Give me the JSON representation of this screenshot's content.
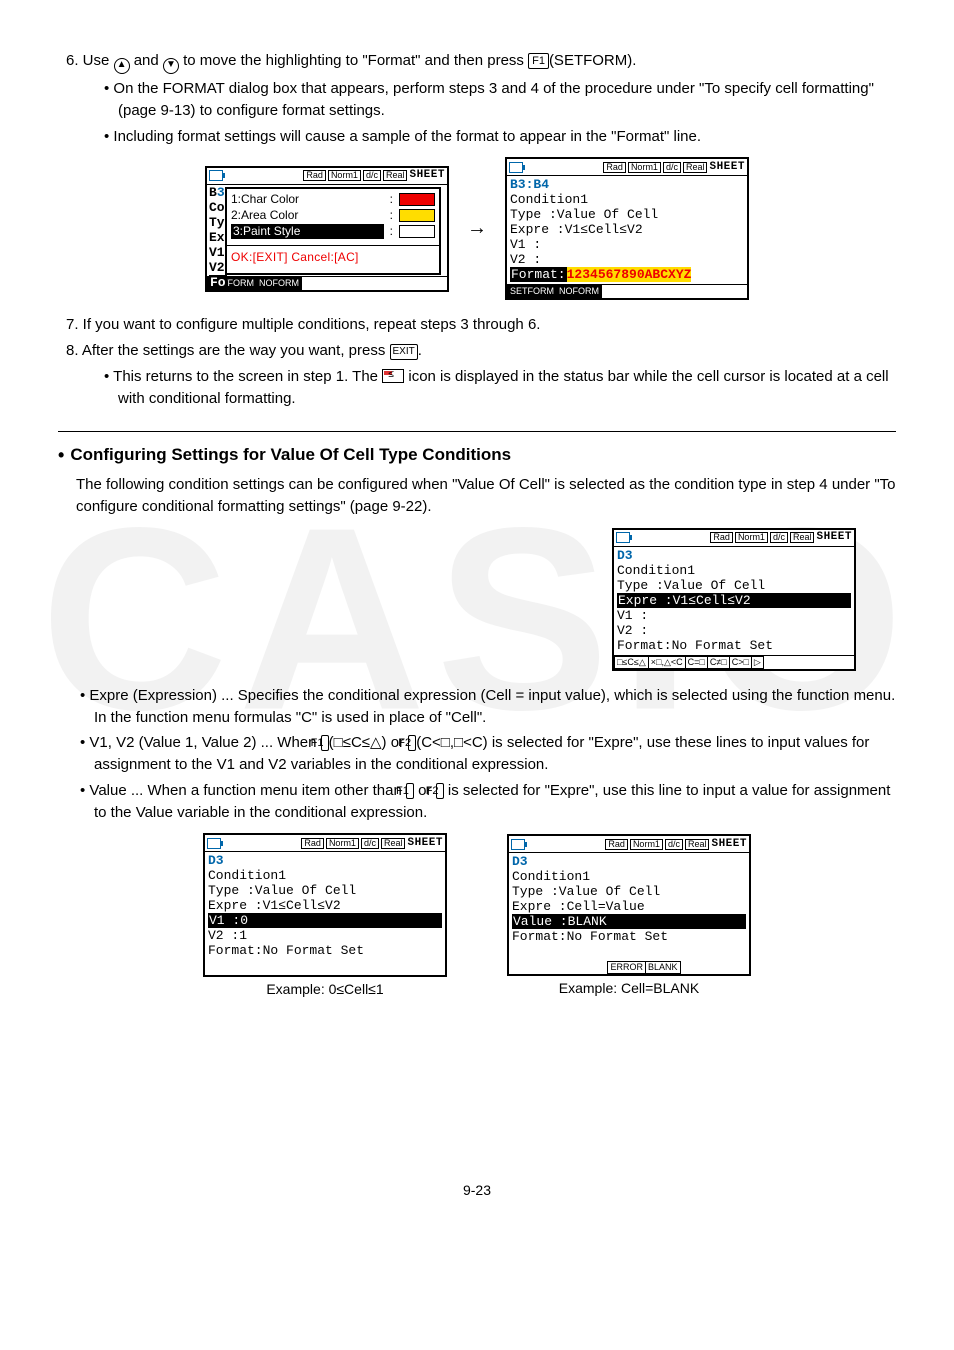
{
  "step6": {
    "text_a": "6. Use ",
    "text_b": " and ",
    "text_c": " to move the highlighting to \"Format\" and then press ",
    "text_d": "(SETFORM).",
    "sub1": "On the FORMAT dialog box that appears, perform steps 3 and 4 of the procedure under \"To specify cell formatting\" (page 9-13) to configure format settings.",
    "sub2": "Including format settings will cause a sample of the format to appear in the \"Format\" line."
  },
  "keys": {
    "up": "▲",
    "down": "▼",
    "f1": "F1",
    "f2": "F2",
    "exit": "EXIT"
  },
  "screens_pair1": {
    "leftPeek": "B3\nCo\nTy\nEx\nV1\nV2\nFo",
    "dlg_opt1": "1:Char Color",
    "dlg_opt2": "2:Area Color",
    "dlg_opt3": "3:Paint Style",
    "dlg_foot": "OK:[EXIT] Cancel:[AC]",
    "fkeys_left": [
      "SETFORM",
      "NOFORM"
    ],
    "cell": "B3:B4",
    "cond": "Condition1",
    "type": "Type   :Value Of Cell",
    "expre": "Expre  :V1≤Cell≤V2",
    "v1": "V1     :",
    "v2": "V2     :",
    "fmtlabel": "Format:",
    "fmtval": "1234567890ABCXYZ",
    "fkeys_right": [
      "SETFORM",
      "NOFORM"
    ]
  },
  "status": {
    "rad": "Rad",
    "norm": "Norm1",
    "dc": "d/c",
    "real": "Real",
    "sheet": "SHEET"
  },
  "step7": "7. If you want to configure multiple conditions, repeat steps 3 through 6.",
  "step8a": "8. After the settings are the way you want, press ",
  "step8b": ".",
  "step8_sub_a": "This returns to the screen in step 1. The ",
  "step8_sub_b": " icon is displayed in the status bar while the cell cursor is located at a cell with conditional formatting.",
  "sect2": {
    "title": "Configuring Settings for Value Of Cell Type Conditions",
    "lead": "The following condition settings can be configured when \"Value Of Cell\" is selected as the condition type in step 4 under \"To configure conditional formatting settings\" (page 9-22)."
  },
  "screen_sect2": {
    "cell": "D3",
    "cond": "Condition1",
    "type": "Type   :Value Of Cell",
    "expre": "Expre  :V1≤Cell≤V2",
    "v1": "V1     :",
    "v2": "V2     :",
    "fmt": "Format:No Format Set",
    "fkeys": [
      "□≤C≤△",
      "×□,△<C",
      "C=□",
      "C≠□",
      "C>□",
      "▷"
    ]
  },
  "bullets2": {
    "b1": "Expre (Expression) ... Specifies the conditional expression (Cell = input value), which is selected using the function menu. In the function menu formulas \"C\" is used in place of \"Cell\".",
    "b2a": "V1, V2 (Value 1, Value 2) ... When ",
    "b2b": "(□≤C≤△) or ",
    "b2c": "(C<□,□<C) is selected for \"Expre\", use these lines to input values for assignment to the V1 and V2 variables in the conditional expression.",
    "b3a": "Value ... When a function menu item other than ",
    "b3b": " or ",
    "b3c": " is selected for \"Expre\", use this line to input a value for assignment to the Value variable in the conditional expression."
  },
  "screens_pair2": {
    "left": {
      "cell": "D3",
      "cond": "Condition1",
      "type": "Type   :Value Of Cell",
      "expre": "Expre  :V1≤Cell≤V2",
      "v1": "V1     :0",
      "v2": "V2     :1",
      "fmt": "Format:No Format Set",
      "caption": "Example: 0≤Cell≤1"
    },
    "right": {
      "cell": "D3",
      "cond": "Condition1",
      "type": "Type   :Value Of Cell",
      "expre": "Expre  :Cell=Value",
      "val": "Value :BLANK",
      "fmt": "Format:No Format Set",
      "fkeys": [
        "ERROR",
        "BLANK"
      ],
      "caption": "Example: Cell=BLANK"
    }
  },
  "page": "9-23"
}
